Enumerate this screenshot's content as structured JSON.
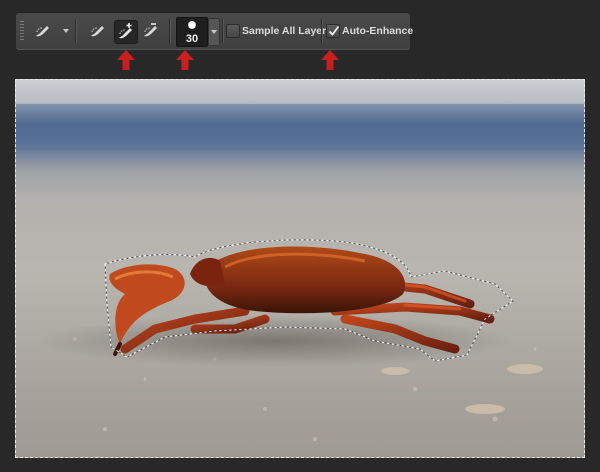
{
  "toolbar": {
    "tool_preset_icon": "quick-selection-brush-icon",
    "mode_icons": [
      "new-selection-brush-icon",
      "add-to-selection-brush-icon",
      "subtract-from-selection-brush-icon"
    ],
    "active_mode": "add-to-selection-brush-icon",
    "brush_size": "30",
    "sample_all_layers": {
      "label": "Sample All Layers",
      "checked": false
    },
    "auto_enhance": {
      "label": "Auto-Enhance",
      "checked": true
    }
  },
  "annotations": {
    "arrow_color": "#c8201e",
    "arrow_targets": [
      "add-to-selection-brush-icon",
      "brush-size-picker",
      "auto-enhance-checkbox"
    ]
  },
  "canvas": {
    "subject": "crab on sandy beach with marching-ants selection",
    "colors": {
      "water": "#4a6488",
      "sand": "#b5b1ab",
      "crab": "#8a2a12",
      "selection": "#ffffff"
    }
  }
}
